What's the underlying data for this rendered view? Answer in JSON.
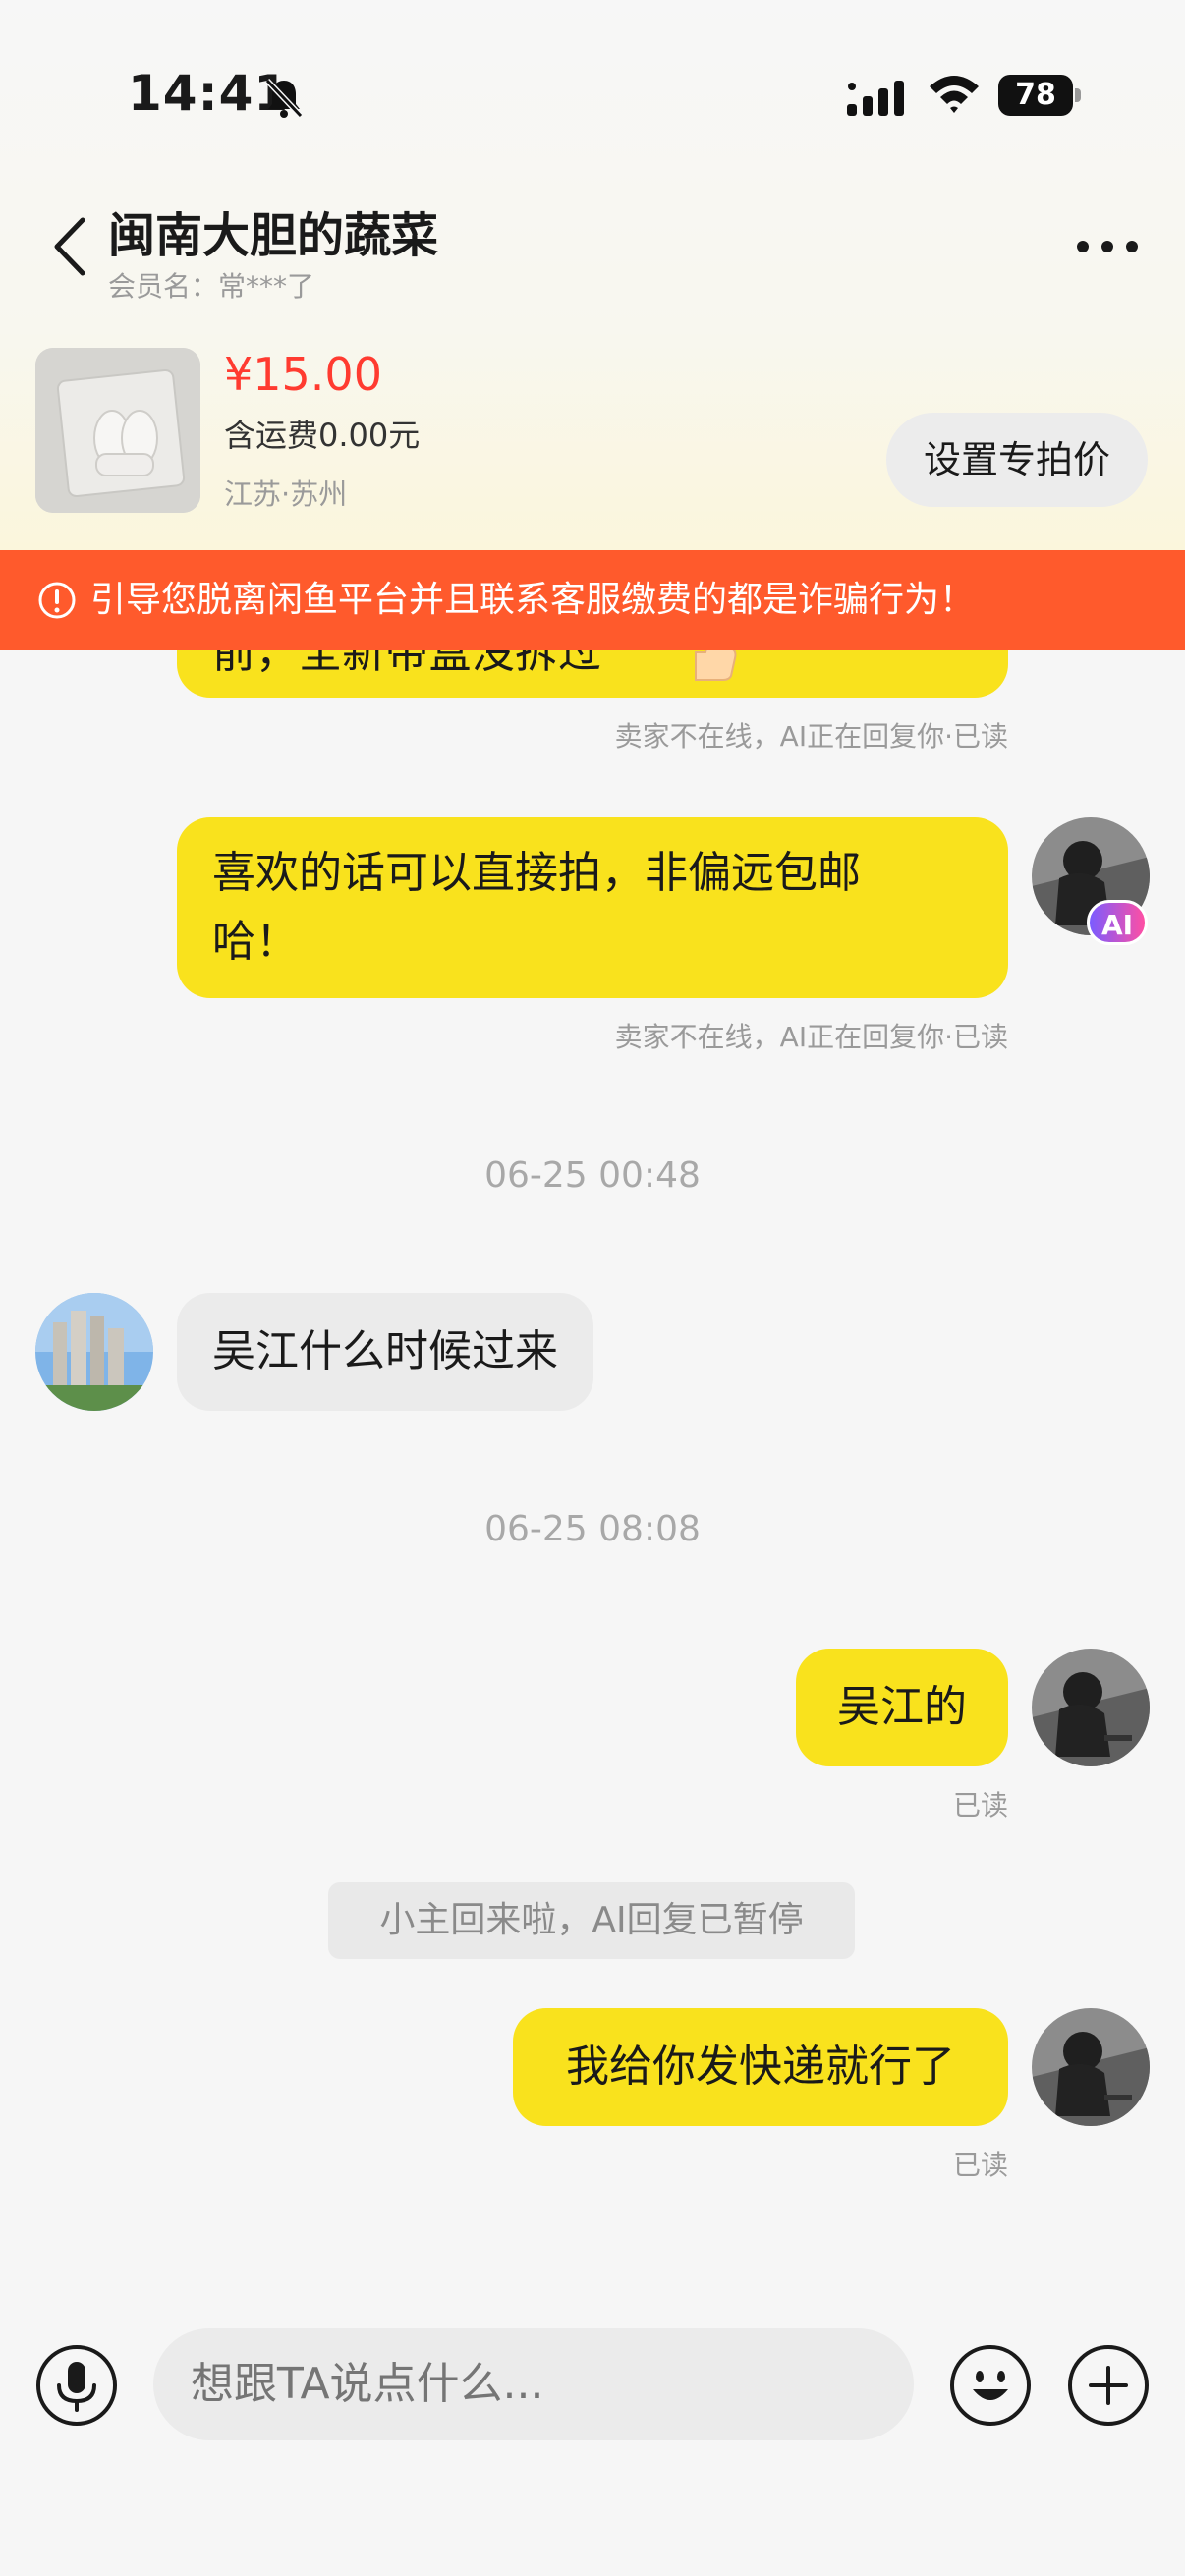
{
  "status_bar": {
    "time": "14:41",
    "battery": "78"
  },
  "header": {
    "title": "闽南大胆的蔬菜",
    "member_label": "会员名：",
    "member_name": "常***了"
  },
  "product": {
    "price": "¥15.00",
    "shipping": "含运费0.00元",
    "location": "江苏·苏州",
    "action_label": "设置专拍价"
  },
  "warning": {
    "text": "引导您脱离闲鱼平台并且联系客服缴费的都是诈骗行为！"
  },
  "messages": [
    {
      "from": "me",
      "text": "前，全新带盒没拆过",
      "status": "卖家不在线，AI正在回复你·已读"
    },
    {
      "from": "me",
      "text_line1": "喜欢的话可以直接拍，非偏远包邮",
      "text_line2": "哈！",
      "status": "卖家不在线，AI正在回复你·已读",
      "badge": "AI"
    },
    {
      "type": "timestamp",
      "text": "06-25 00:48"
    },
    {
      "from": "other",
      "text": "吴江什么时候过来"
    },
    {
      "type": "timestamp",
      "text": "06-25 08:08"
    },
    {
      "from": "me",
      "text": "吴江的",
      "status": "已读"
    },
    {
      "type": "system",
      "text": "小主回来啦，AI回复已暂停"
    },
    {
      "from": "me",
      "text": "我给你发快递就行了",
      "status": "已读"
    }
  ],
  "input": {
    "placeholder": "想跟TA说点什么..."
  },
  "colors": {
    "accent_yellow": "#f9e21d",
    "warning_orange": "#ff5a2c",
    "price_red": "#ff3b30"
  }
}
